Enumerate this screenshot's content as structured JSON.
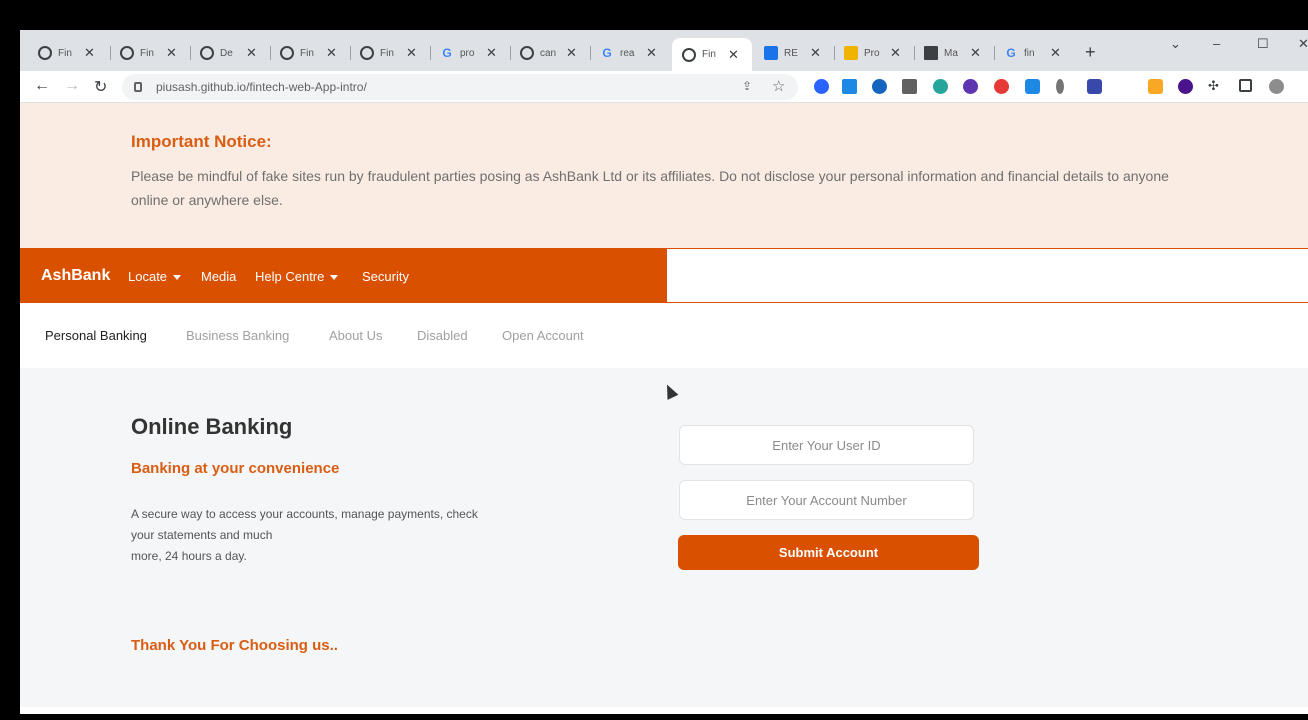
{
  "browser": {
    "tabs": [
      {
        "title": "Fin",
        "icon": "github-icon"
      },
      {
        "title": "Fin",
        "icon": "globe-icon"
      },
      {
        "title": "De",
        "icon": "github-icon"
      },
      {
        "title": "Fin",
        "icon": "globe-icon"
      },
      {
        "title": "Fin",
        "icon": "globe-icon"
      },
      {
        "title": "pro",
        "icon": "google-icon"
      },
      {
        "title": "can",
        "icon": "github-icon"
      },
      {
        "title": "rea",
        "icon": "google-icon"
      },
      {
        "title": "Fin",
        "icon": "globe-icon",
        "active": true
      },
      {
        "title": "RE",
        "icon": "x-icon"
      },
      {
        "title": "Pro",
        "icon": "m-icon"
      },
      {
        "title": "Ma",
        "icon": "doc-icon"
      },
      {
        "title": "fin",
        "icon": "google-icon"
      }
    ],
    "new_tab": "+",
    "window_controls": {
      "minimize": "‒",
      "maximize": "☐",
      "close": "✕",
      "dropdown": "⌄"
    },
    "url": "piusash.github.io/fintech-web-App-intro/"
  },
  "notice": {
    "title": "Important Notice:",
    "body": "Please be mindful of fake sites run by fraudulent parties posing as AshBank Ltd or its affiliates. Do not disclose your personal information and financial details to anyone online or anywhere else."
  },
  "navbar": {
    "brand": "AshBank",
    "links": [
      "Locate",
      "Media",
      "Help Centre",
      "Security"
    ]
  },
  "subnav": {
    "links": [
      "Personal Banking",
      "Business Banking",
      "About Us",
      "Disabled",
      "Open Account"
    ]
  },
  "main": {
    "heading": "Online Banking",
    "subheading": "Banking at your convenience",
    "description_lines": [
      "A secure way to access your accounts, manage payments, check",
      "your statements and much",
      "more, 24 hours a day."
    ],
    "thanks": "Thank You For Choosing us.."
  },
  "form": {
    "user_id_placeholder": "Enter Your User ID",
    "account_placeholder": "Enter Your Account Number",
    "submit_label": "Submit Account"
  },
  "colors": {
    "brand_orange": "#d95000",
    "notice_bg": "#faece3"
  }
}
